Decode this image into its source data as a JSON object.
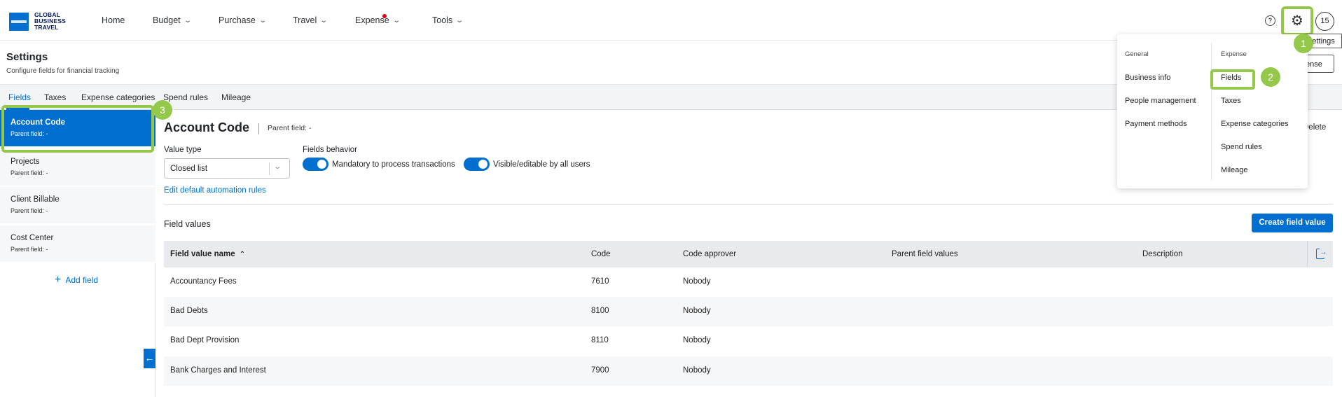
{
  "brand": {
    "line1": "GLOBAL",
    "line2": "BUSINESS",
    "line3": "TRAVEL"
  },
  "nav": {
    "home": "Home",
    "budget": "Budget",
    "purchase": "Purchase",
    "travel": "Travel",
    "expense": "Expense",
    "tools": "Tools",
    "help": "?",
    "avatar": "15",
    "expense_notification_color": "#d7001b"
  },
  "page": {
    "title": "Settings",
    "subtitle": "Configure fields for financial tracking"
  },
  "tabs": [
    "Fields",
    "Taxes",
    "Expense categories",
    "Spend rules",
    "Mileage"
  ],
  "sidebar": {
    "items": [
      {
        "name": "Account Code",
        "parent": "Parent field:  -"
      },
      {
        "name": "Projects",
        "parent": "Parent field:  -"
      },
      {
        "name": "Client Billable",
        "parent": "Parent field:  -"
      },
      {
        "name": "Cost Center",
        "parent": "Parent field:  -"
      }
    ],
    "add_field": "Add field",
    "collapse": "←"
  },
  "detail": {
    "title": "Account Code",
    "parent": "Parent field:  -",
    "delete": "Delete",
    "value_type_label": "Value type",
    "value_type": "Closed list",
    "fields_behavior_label": "Fields behavior",
    "toggle1": "Mandatory to process transactions",
    "toggle2": "Visible/editable by all users",
    "automation_link": "Edit default automation rules"
  },
  "field_values": {
    "title": "Field values",
    "create_button": "Create field value",
    "columns": [
      "Field value name",
      "Code",
      "Code approver",
      "Parent field values",
      "Description"
    ],
    "rows": [
      {
        "name": "Accountancy Fees",
        "code": "7610",
        "approver": "Nobody",
        "parent": "",
        "description": ""
      },
      {
        "name": "Bad Debts",
        "code": "8100",
        "approver": "Nobody",
        "parent": "",
        "description": ""
      },
      {
        "name": "Bad Dept Provision",
        "code": "8110",
        "approver": "Nobody",
        "parent": "",
        "description": ""
      },
      {
        "name": "Bank Charges and Interest",
        "code": "7900",
        "approver": "Nobody",
        "parent": "",
        "description": ""
      }
    ]
  },
  "settings_menu": {
    "general_header": "General",
    "general_items": [
      "Business info",
      "People management",
      "Payment methods"
    ],
    "expense_header": "Expense",
    "expense_items": [
      "Fields",
      "Taxes",
      "Expense categories",
      "Spend rules",
      "Mileage"
    ],
    "tooltip": "Settings",
    "partial_button": "ense"
  },
  "annotations": {
    "step1": "1",
    "step2": "2",
    "step3": "3",
    "color": "#93c84a"
  },
  "colors": {
    "accent": "#006fcf",
    "header_bg": "#f3f4f6"
  }
}
